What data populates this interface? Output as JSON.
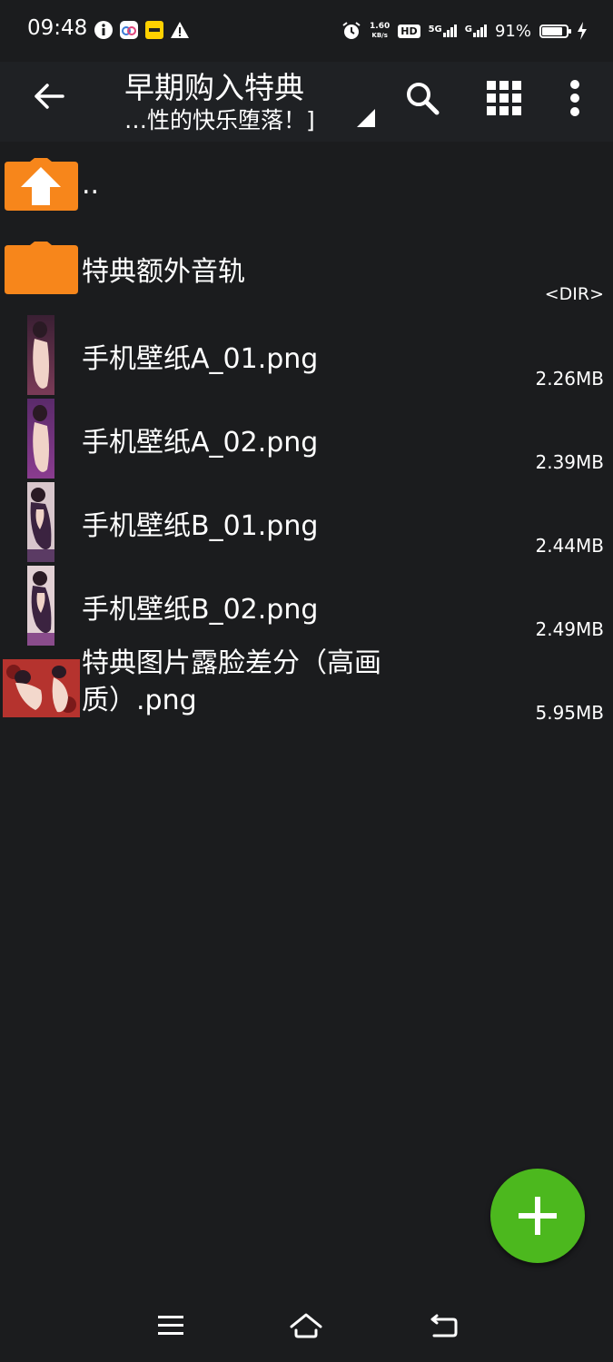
{
  "status_bar": {
    "time": "09:48",
    "net_speed_value": "1.60",
    "net_speed_unit": "KB/s",
    "hd_badge": "HD",
    "network_5g": "5G",
    "network_g": "G",
    "battery_percent": "91%",
    "battery_level": 0.91,
    "icons": [
      "info-icon",
      "app-notification-icon",
      "meituan-icon",
      "warning-icon",
      "alarm-icon",
      "hd-icon",
      "signal-5g-icon",
      "signal-g-icon",
      "battery-icon",
      "charging-icon"
    ]
  },
  "toolbar": {
    "title": "早期购入特典",
    "subtitle": "…性的快乐堕落！]",
    "actions": [
      "back-arrow-icon",
      "search-icon",
      "grid-view-icon",
      "more-vert-icon"
    ]
  },
  "files": [
    {
      "name": "..",
      "meta": "",
      "type": "parent-folder"
    },
    {
      "name": "特典额外音轨",
      "meta": "<DIR>",
      "type": "folder"
    },
    {
      "name": "手机壁纸A_01.png",
      "meta": "2.26MB",
      "type": "image"
    },
    {
      "name": "手机壁纸A_02.png",
      "meta": "2.39MB",
      "type": "image"
    },
    {
      "name": "手机壁纸B_01.png",
      "meta": "2.44MB",
      "type": "image"
    },
    {
      "name": "手机壁纸B_02.png",
      "meta": "2.49MB",
      "type": "image"
    },
    {
      "name": "特典图片露脸差分（高画质）.png",
      "name_line1": "特典图片露脸差分（高画",
      "name_line2": "质）.png",
      "meta": "5.95MB",
      "type": "image-wide"
    }
  ],
  "colors": {
    "background": "#1b1c1e",
    "toolbar": "#1f2124",
    "folder": "#f7861b",
    "fab": "#4cb81e"
  },
  "fab": {
    "icon": "plus-icon"
  },
  "nav": {
    "icons": [
      "menu-icon",
      "home-icon",
      "back-icon"
    ]
  }
}
